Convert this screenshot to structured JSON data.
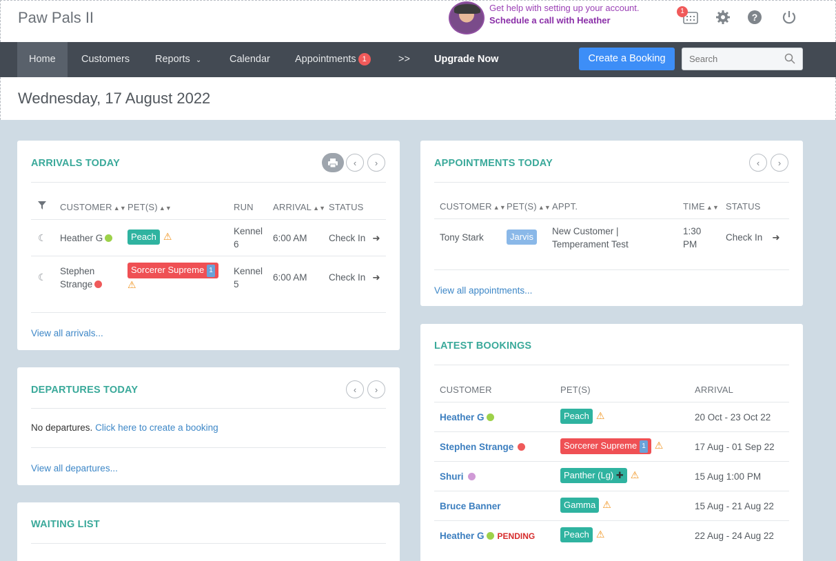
{
  "app": {
    "title": "Paw Pals II"
  },
  "help": {
    "line1": "Get help with setting up your account.",
    "line2": "Schedule a call with Heather"
  },
  "top_icons": {
    "calendar_badge": "1"
  },
  "nav": {
    "home": "Home",
    "customers": "Customers",
    "reports": "Reports",
    "calendar": "Calendar",
    "appointments": "Appointments",
    "appointments_badge": "1",
    "more": ">>",
    "upgrade": "Upgrade Now",
    "create_booking": "Create a Booking",
    "search_placeholder": "Search"
  },
  "date": "Wednesday, 17 August 2022",
  "arrivals": {
    "title": "ARRIVALS TODAY",
    "headers": {
      "customer": "CUSTOMER",
      "pets": "PET(S)",
      "run": "RUN",
      "arrival": "ARRIVAL",
      "status": "STATUS"
    },
    "rows": [
      {
        "customer": "Heather G",
        "dot": "#9dd14a",
        "pet": "Peach",
        "pet_color": "#2fb3a0",
        "run": "Kennel 6",
        "arrival": "6:00 AM",
        "status": "Check In"
      },
      {
        "customer": "Stephen Strange",
        "dot": "#ef5a5a",
        "pet": "Sorcerer Supreme",
        "pet_color": "#ef5054",
        "run": "Kennel 5",
        "arrival": "6:00 AM",
        "status": "Check In"
      }
    ],
    "footer": "View all arrivals..."
  },
  "departures": {
    "title": "DEPARTURES TODAY",
    "empty": "No departures.",
    "empty_link": "Click here to create a booking",
    "footer": "View all departures..."
  },
  "waiting": {
    "title": "WAITING LIST"
  },
  "appointments": {
    "title": "APPOINTMENTS TODAY",
    "headers": {
      "customer": "CUSTOMER",
      "pets": "PET(S)",
      "appt": "APPT.",
      "time": "TIME",
      "status": "STATUS"
    },
    "rows": [
      {
        "customer": "Tony Stark",
        "pet": "Jarvis",
        "appt": "New Customer | Temperament Test",
        "time": "1:30 PM",
        "status": "Check In"
      }
    ],
    "footer": "View all appointments..."
  },
  "bookings": {
    "title": "LATEST BOOKINGS",
    "headers": {
      "customer": "CUSTOMER",
      "pets": "PET(S)",
      "arrival": "ARRIVAL"
    },
    "rows": [
      {
        "customer": "Heather G",
        "dot": "#9dd14a",
        "pending": "",
        "pet": "Peach",
        "pet_color": "#2fb3a0",
        "arrival": "20 Oct - 23 Oct 22"
      },
      {
        "customer": "Stephen Strange",
        "dot": "#ef5a5a",
        "pending": "",
        "pet": "Sorcerer Supreme",
        "pet_color": "#ef5054",
        "arrival": "17 Aug - 01 Sep 22"
      },
      {
        "customer": "Shuri",
        "dot": "#d09ad6",
        "pending": "",
        "pet": "Panther (Lg)",
        "pet_color": "#2fb3a0",
        "arrival": "15 Aug 1:00 PM"
      },
      {
        "customer": "Bruce Banner",
        "dot": "",
        "pending": "",
        "pet": "Gamma",
        "pet_color": "#2fb3a0",
        "arrival": "15 Aug - 21 Aug 22"
      },
      {
        "customer": "Heather G",
        "dot": "#9dd14a",
        "pending": "PENDING",
        "pet": "Peach",
        "pet_color": "#2fb3a0",
        "arrival": "22 Aug - 24 Aug 22"
      }
    ]
  }
}
